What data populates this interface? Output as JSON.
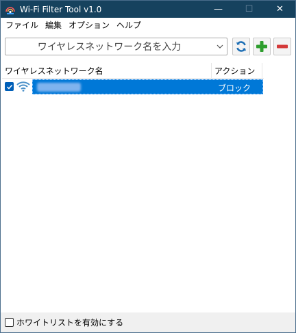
{
  "window": {
    "title": "Wi-Fi Filter Tool v1.0",
    "minimize": "—",
    "maximize": "☐",
    "close": "✕"
  },
  "menu": {
    "file": "ファイル",
    "edit": "編集",
    "options": "オプション",
    "help": "ヘルプ"
  },
  "toolbar": {
    "ssid_input": "ワイヤレスネットワーク名を入力",
    "refresh_icon": "refresh-icon",
    "add_icon": "add-icon",
    "remove_icon": "remove-icon"
  },
  "list": {
    "columns": [
      "ワイヤレスネットワーク名",
      "アクション"
    ],
    "rows": [
      {
        "checked": true,
        "name": "",
        "action": "ブロック"
      }
    ]
  },
  "footer": {
    "whitelist_label": "ホワイトリストを有効にする",
    "whitelist_checked": false
  },
  "colors": {
    "titlebar": "#16425e",
    "selection": "#0078d7",
    "add_green": "#2e9e2e",
    "remove_red": "#d43a3a",
    "refresh_blue": "#1e6fb5"
  }
}
